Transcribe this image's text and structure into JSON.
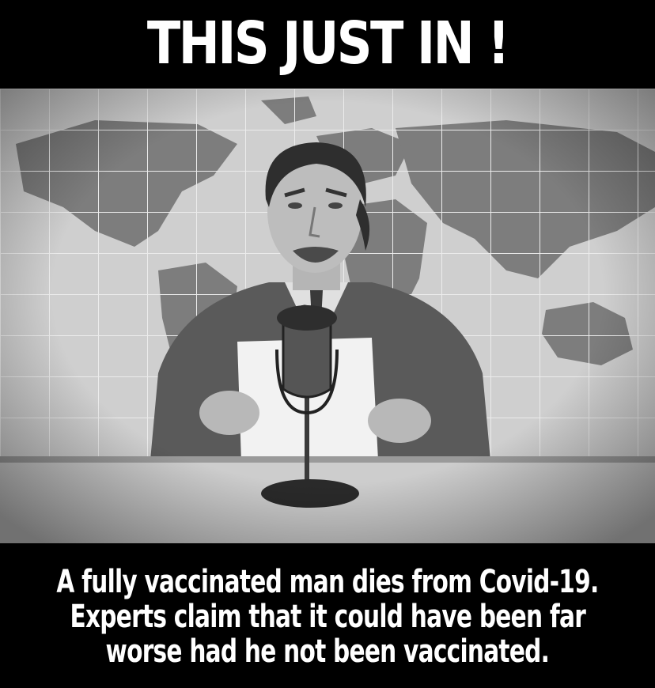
{
  "headline": {
    "text": "THIS JUST IN !"
  },
  "photo": {
    "description_icon": "news-anchor-illustration"
  },
  "caption": {
    "lines": [
      "A fully vaccinated man dies from Covid-19.",
      "Experts claim that it could have been far",
      "worse had he not been vaccinated."
    ]
  },
  "colors": {
    "background": "#000000",
    "text": "#ffffff",
    "map_water": "#d0d0d0",
    "map_land": "#7a7a7a",
    "suit": "#5a5a5a",
    "desk": "#cfcfcf"
  }
}
